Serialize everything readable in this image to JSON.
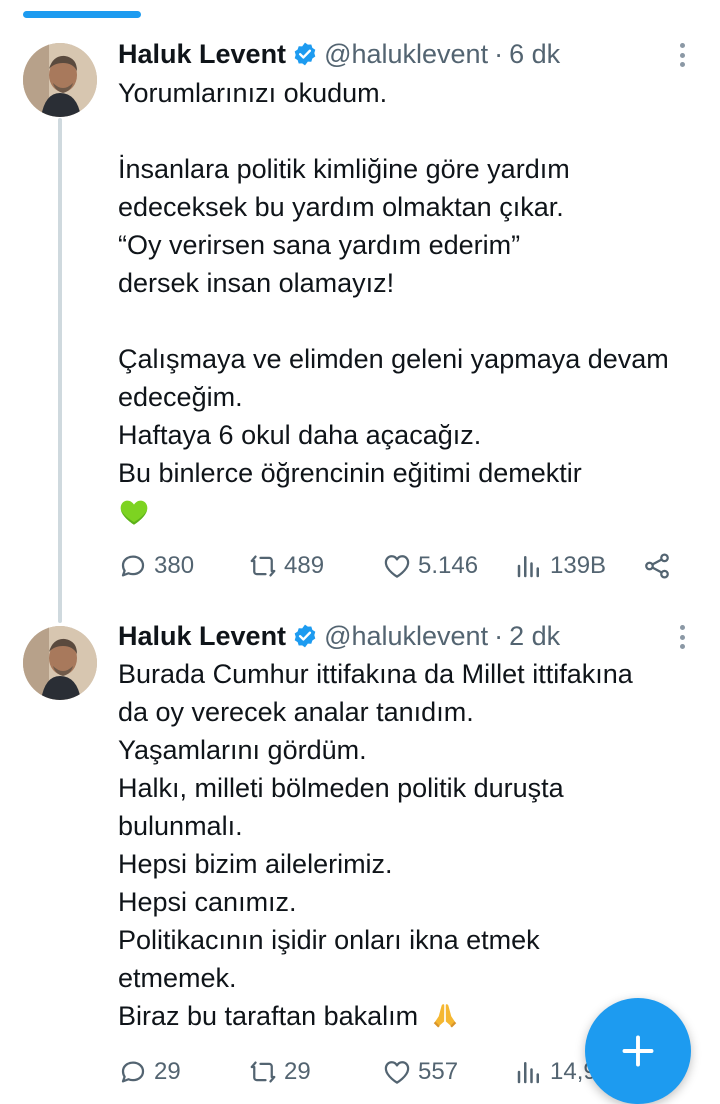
{
  "tweets": [
    {
      "name": "Haluk Levent",
      "handle": "@haluklevent",
      "separator": "·",
      "time": "6 dk",
      "lines": [
        "Yorumlarınızı okudum.",
        "",
        "İnsanlara politik kimliğine göre yardım",
        "edeceksek bu yardım olmaktan çıkar.",
        "“Oy verirsen sana yardım ederim”",
        "dersek insan olamayız!",
        "",
        "Çalışmaya ve elimden geleni yapmaya devam",
        "edeceğim.",
        "Haftaya 6 okul daha açacağız.",
        "Bu binlerce öğrencinin eğitimi demektir"
      ],
      "emoji": "green-heart",
      "replies": "380",
      "retweets": "489",
      "likes": "5.146",
      "views": "139B"
    },
    {
      "name": "Haluk Levent",
      "handle": "@haluklevent",
      "separator": "·",
      "time": "2 dk",
      "lines": [
        "Burada Cumhur ittifakına da Millet ittifakına",
        "da oy verecek analar tanıdım.",
        "Yaşamlarını gördüm.",
        "Halkı, milleti bölmeden politik duruşta",
        "bulunmalı.",
        "Hepsi bizim ailelerimiz.",
        "Hepsi canımız.",
        "Politikacının işidir onları ikna etmek",
        "etmemek.",
        "Biraz bu taraftan bakalım"
      ],
      "emoji": "folded-hands",
      "replies": "29",
      "retweets": "29",
      "likes": "557",
      "views": "14,9"
    }
  ],
  "colors": {
    "accent": "#1d9bf0",
    "secondary_text": "#536471",
    "thread_line": "#cfd9de"
  }
}
